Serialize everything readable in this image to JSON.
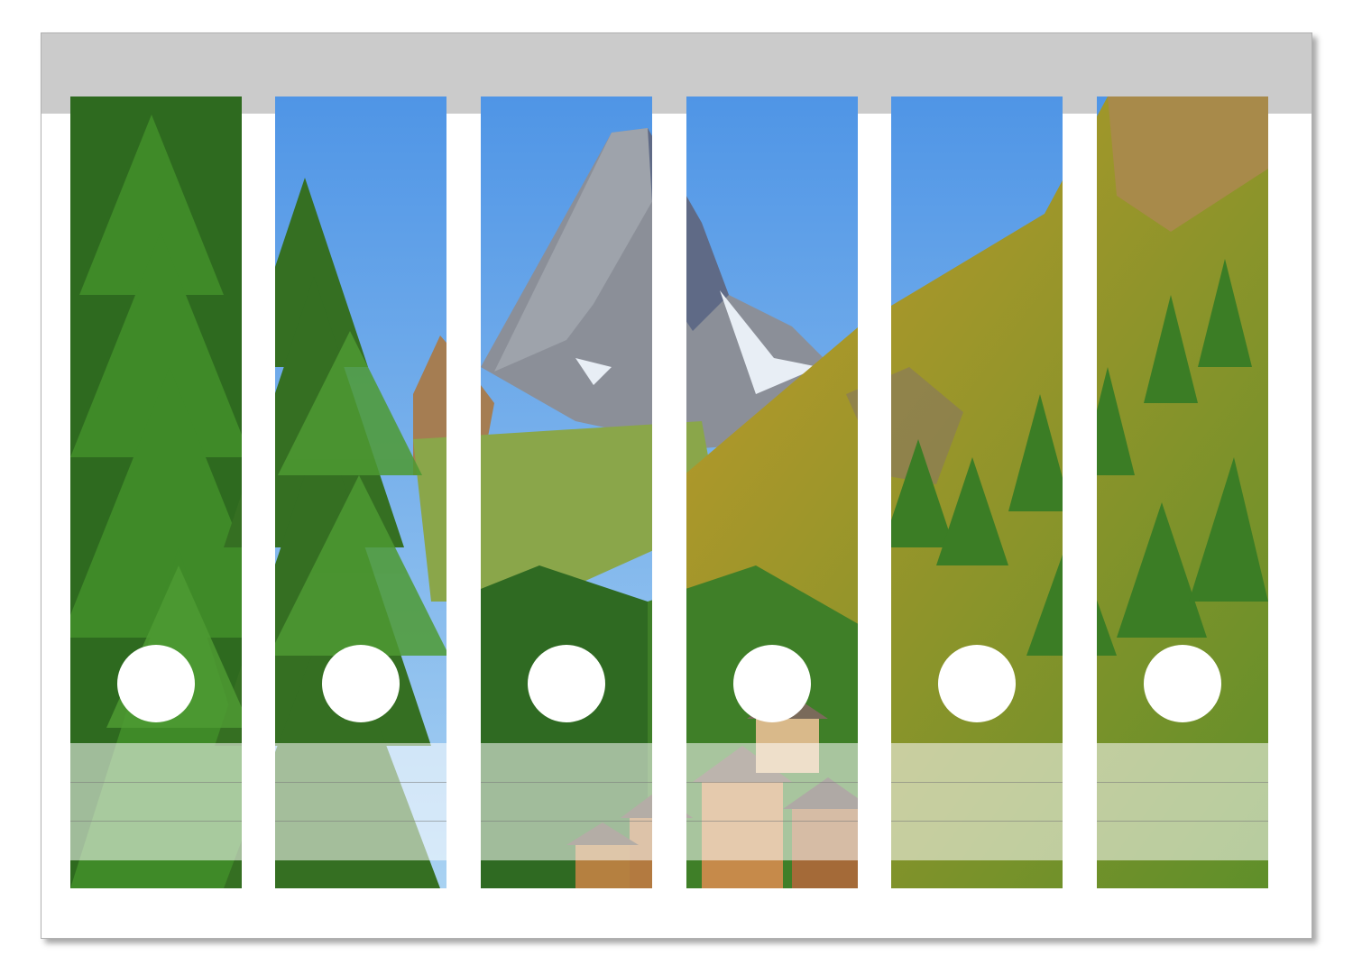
{
  "sheet": {
    "label_count": 6,
    "label_band_lines": 2
  },
  "colors": {
    "sky": "#4f95e6",
    "sky_light": "#a9d2f2",
    "rock": "#8b8f98",
    "snow": "#e8eef5",
    "forest": "#3f7a22",
    "meadow": "#c49a2a",
    "header_band": "#cbcbcb"
  }
}
